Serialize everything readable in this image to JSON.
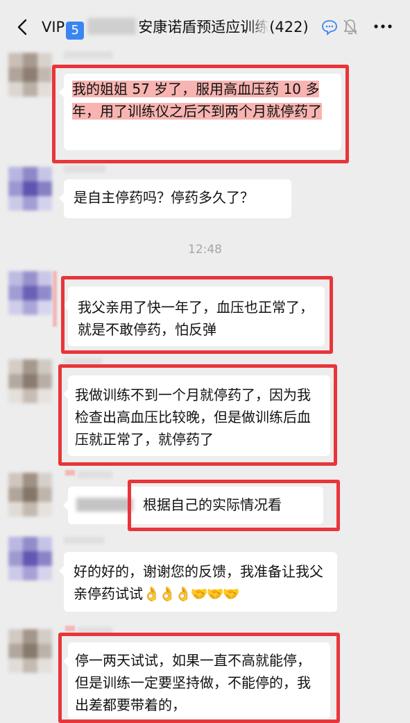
{
  "header": {
    "back_icon": "chevron-left-icon",
    "vip_label": "VIP",
    "vip_level": "5",
    "group_name": "安康诺盾预适应训练",
    "member_count": "(422)",
    "chat_icon": "chat-bubble-icon",
    "mute_icon": "bell-off-icon",
    "more_icon": "more-icon"
  },
  "messages": [
    {
      "text": "我的姐姐 57 岁了，服用高血压药 10 多年，用了训练仪之后不到两个月就停药了"
    },
    {
      "text": "是自主停药吗？停药多久了？"
    },
    {
      "text": "我父亲用了快一年了，血压也正常了，就是不敢停药，怕反弹"
    },
    {
      "text": "我做训练不到一个月就停药了，因为我检查出高血压比较晚，但是做训练后血压就正常了，就停药了"
    },
    {
      "text": "根据自己的实际情况看"
    },
    {
      "text": "好的好的，谢谢您的反馈，我准备让我父亲停药试试",
      "emojis": "👌👌👌🤝🤝🤝"
    },
    {
      "text": "停一两天试试，如果一直不高就能停，但是训练一定要坚持做，不能停的，我出差都要带着的，"
    }
  ],
  "timestamp": "12:48",
  "colors": {
    "background": "#ededed",
    "bubble": "#ffffff",
    "highlight": "#f7b4b1",
    "annotation_red": "#e8353a",
    "vip_blue": "#3a86f0"
  }
}
